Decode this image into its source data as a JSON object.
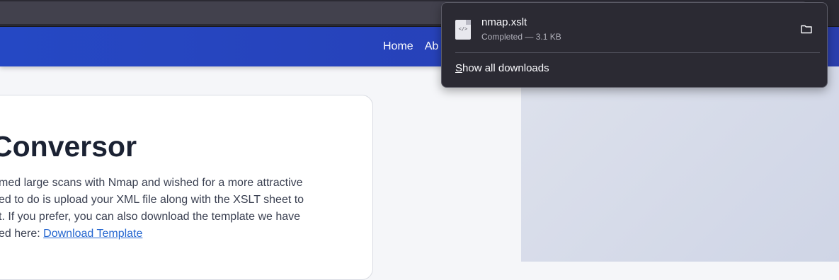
{
  "browser": {},
  "nav": {
    "links": [
      "Home",
      "Ab"
    ]
  },
  "card": {
    "title": "Conversor",
    "lines": [
      "med large scans with Nmap and wished for a more attractive",
      "ed to do is upload your XML file along with the XSLT sheet to",
      "t. If you prefer, you can also download the template we have",
      "ed here: "
    ],
    "download_link": "Download Template"
  },
  "downloads": {
    "file_icon": "code-file-icon",
    "file_icon_glyph": "</>",
    "file_name": "nmap.xslt",
    "status": "Completed — 3.1 KB",
    "folder_icon": "folder-icon",
    "show_all_first_letter": "S",
    "show_all_rest": "how all downloads"
  },
  "colors": {
    "nav_blue": "#2548c4",
    "link_blue": "#2466d0",
    "panel_bg": "#2b2a33"
  }
}
